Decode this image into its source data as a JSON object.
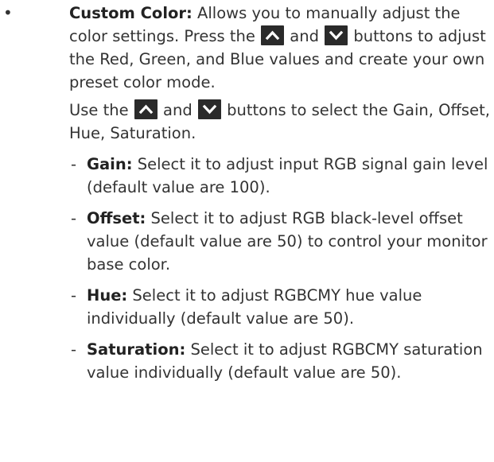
{
  "bullet_glyph": "•",
  "main_item": {
    "title": "Custom Color:",
    "intro_part1": " Allows you to manually adjust the color settings. Press the ",
    "intro_part2": " and ",
    "intro_part3": " buttons to adjust the Red, Green, and Blue values and create your own preset color mode.",
    "select_part1": "Use the ",
    "select_part2": " and ",
    "select_part3": " buttons to select the Gain, Offset, Hue, Saturation."
  },
  "icons": {
    "up": "up-arrow-button",
    "down": "down-arrow-button",
    "button_bg_color": "#2a2a2a",
    "arrow_color": "#ffffff"
  },
  "sub_items": [
    {
      "dash": "-",
      "label": "Gain:",
      "text": " Select it to adjust input RGB signal gain level (default value are 100)."
    },
    {
      "dash": "-",
      "label": "Offset:",
      "text": " Select it to adjust RGB black-level offset value (default value are 50) to control your monitor base color."
    },
    {
      "dash": "-",
      "label": "Hue:",
      "text": " Select it to adjust RGBCMY hue value individually (default value are 50)."
    },
    {
      "dash": "-",
      "label": "Saturation:",
      "text": " Select it to adjust RGBCMY saturation value individually (default value are 50)."
    }
  ]
}
